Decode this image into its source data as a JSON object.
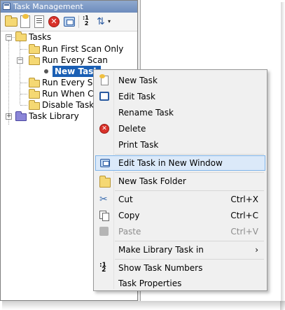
{
  "panel": {
    "title": "Task Management",
    "toolbar": {
      "new_folder": "folder-icon",
      "new_task": "new-task-icon",
      "edit_task": "edit-task-icon",
      "delete": "delete-icon",
      "new_window": "window-icon",
      "task_numbers": "1\n2",
      "sort": "sort-icon",
      "dropdown": "▾"
    }
  },
  "tree": {
    "root": "Tasks",
    "items": [
      {
        "label": "Run First Scan Only"
      },
      {
        "label": "Run Every Scan"
      },
      {
        "label": "New Task"
      },
      {
        "label": "Run Every Seco"
      },
      {
        "label": "Run When Calle"
      },
      {
        "label": "Disable Task"
      }
    ],
    "library": "Task Library",
    "expand_minus": "−",
    "expand_plus": "+"
  },
  "menu": {
    "items": [
      {
        "label": "New Task",
        "shortcut": "",
        "icon": "new-task-icon"
      },
      {
        "label": "Edit Task",
        "shortcut": "",
        "icon": "edit-task-icon"
      },
      {
        "label": "Rename Task",
        "shortcut": "",
        "icon": ""
      },
      {
        "label": "Delete",
        "shortcut": "",
        "icon": "delete-icon"
      },
      {
        "label": "Print Task",
        "shortcut": "",
        "icon": ""
      },
      {
        "label": "Edit Task in New Window",
        "shortcut": "",
        "icon": "window-icon"
      },
      {
        "label": "New Task Folder",
        "shortcut": "",
        "icon": "folder-icon"
      },
      {
        "label": "Cut",
        "shortcut": "Ctrl+X",
        "icon": "cut-icon"
      },
      {
        "label": "Copy",
        "shortcut": "Ctrl+C",
        "icon": "copy-icon"
      },
      {
        "label": "Paste",
        "shortcut": "Ctrl+V",
        "icon": "paste-icon"
      },
      {
        "label": "Make Library Task in",
        "shortcut": "",
        "icon": ""
      },
      {
        "label": "Show Task Numbers",
        "shortcut": "",
        "icon": "task-numbers-icon"
      },
      {
        "label": "Task Properties",
        "shortcut": "",
        "icon": ""
      }
    ],
    "submenu_arrow": "›",
    "highlight_color": "#dbe9f9",
    "highlight_border": "#7eb4ea",
    "disabled_color": "#8d8d8d"
  },
  "colors": {
    "title_bar": "#7a97c6",
    "selection": "#1a5fb4",
    "folder": "#f5d873",
    "library_folder": "#8b86d8"
  }
}
